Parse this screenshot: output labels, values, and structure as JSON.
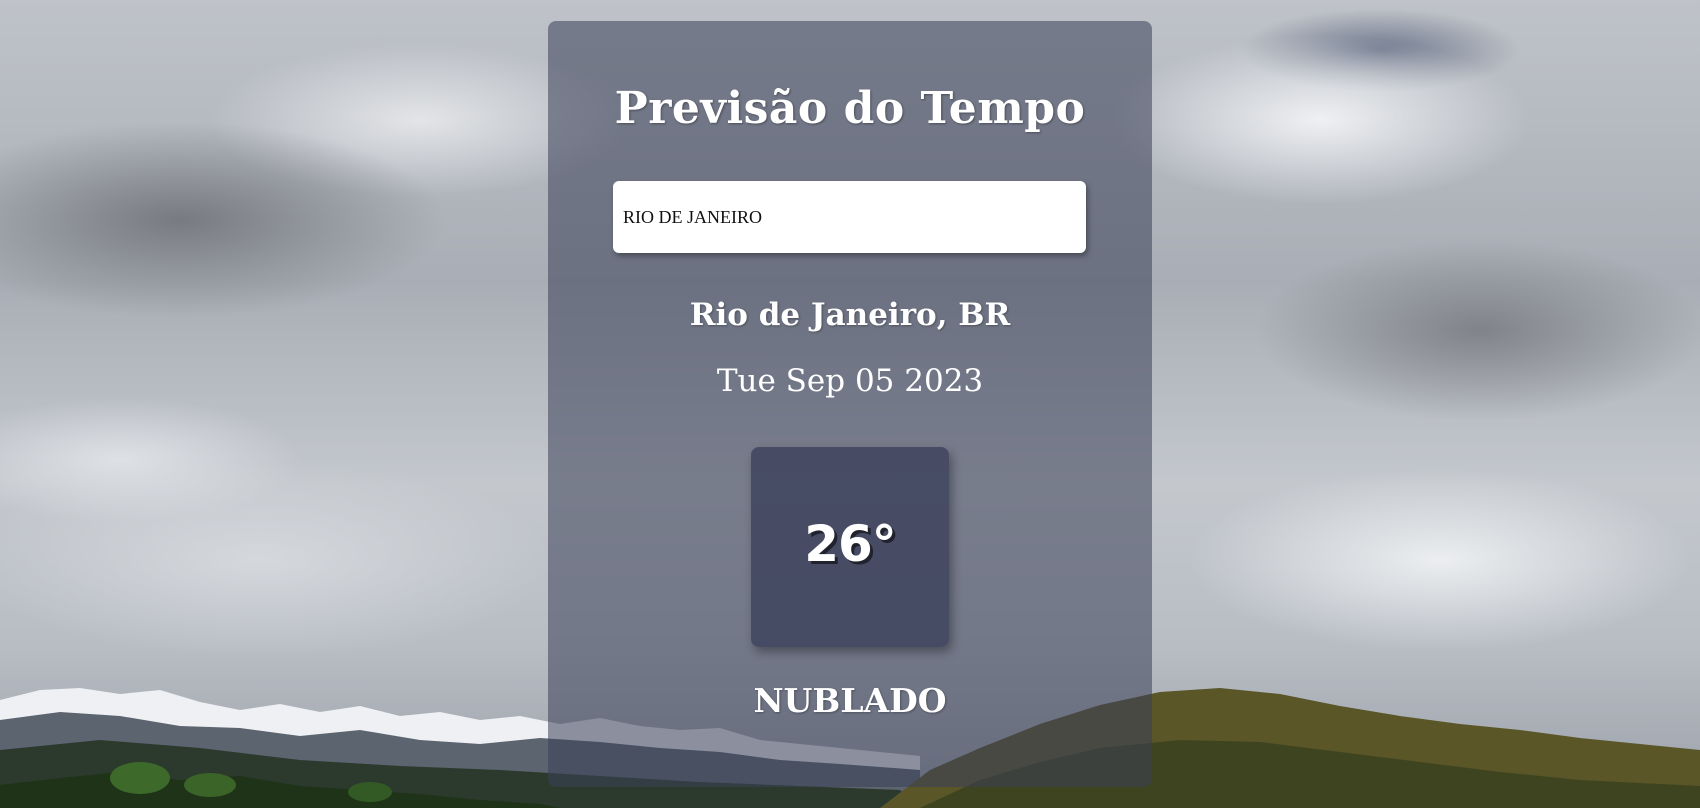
{
  "app": {
    "title": "Previsão do Tempo"
  },
  "search": {
    "value": "RIO DE JANEIRO"
  },
  "weather": {
    "location": "Rio de Janeiro, BR",
    "date": "Tue Sep 05 2023",
    "temperature": "26°",
    "condition": "NUBLADO"
  },
  "colors": {
    "card_background": "#3a4058",
    "text": "#ffffff",
    "input_background": "#ffffff"
  }
}
